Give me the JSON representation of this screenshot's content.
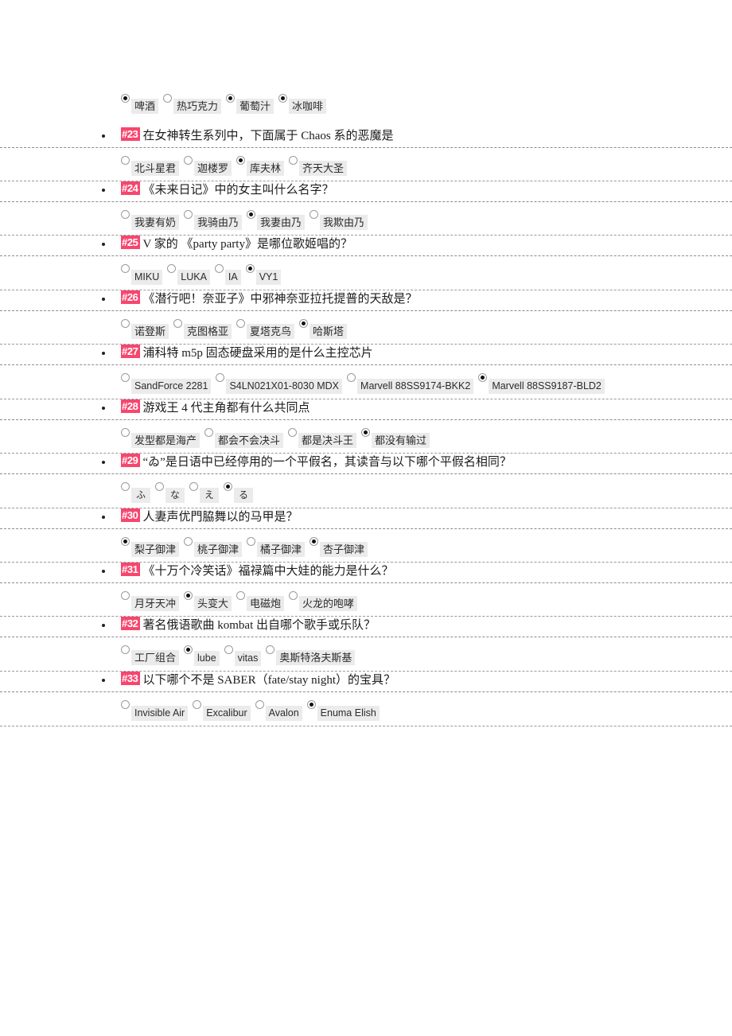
{
  "document": {
    "type": "quiz-answer-sheet",
    "badge_color": "#f7466e",
    "option_bg": "#ebebeb"
  },
  "partial_question": {
    "options": [
      {
        "label": "啤酒",
        "selected": true
      },
      {
        "label": "热巧克力",
        "selected": false
      },
      {
        "label": "葡萄汁",
        "selected": true
      },
      {
        "label": "冰咖啡",
        "selected": true
      }
    ]
  },
  "questions": [
    {
      "number": "#23",
      "text": "在女神转生系列中，下面属于 Chaos 系的恶魔是",
      "style": "cjk",
      "options": [
        {
          "label": "北斗星君",
          "selected": false
        },
        {
          "label": "迦楼罗",
          "selected": false
        },
        {
          "label": "库夫林",
          "selected": true
        },
        {
          "label": "齐天大圣",
          "selected": false
        }
      ]
    },
    {
      "number": "#24",
      "text": "《未来日记》中的女主叫什么名字？",
      "style": "cjk",
      "options": [
        {
          "label": "我妻有奶",
          "selected": false
        },
        {
          "label": "我骑由乃",
          "selected": false
        },
        {
          "label": "我妻由乃",
          "selected": true
        },
        {
          "label": "我欺由乃",
          "selected": false
        }
      ]
    },
    {
      "number": "#25",
      "text": "V 家的 《party party》是哪位歌姬唱的？",
      "style": "cjk",
      "options": [
        {
          "label": "MIKU",
          "selected": false,
          "latin": true
        },
        {
          "label": "LUKA",
          "selected": false,
          "latin": true
        },
        {
          "label": "IA",
          "selected": false,
          "latin": true
        },
        {
          "label": "VY1",
          "selected": true,
          "latin": true
        }
      ]
    },
    {
      "number": "#26",
      "text": "《潜行吧！奈亚子》中邪神奈亚拉托提普的天敌是？",
      "style": "cjk",
      "options": [
        {
          "label": "诺登斯",
          "selected": false
        },
        {
          "label": "克图格亚",
          "selected": false
        },
        {
          "label": "夏塔克鸟",
          "selected": false
        },
        {
          "label": "哈斯塔",
          "selected": true
        }
      ]
    },
    {
      "number": "#27",
      "text": "浦科特 m5p 固态硬盘采用的是什么主控芯片",
      "style": "cjk",
      "options": [
        {
          "label": "SandForce 2281",
          "selected": false,
          "latin": true
        },
        {
          "label": "S4LN021X01-8030 MDX",
          "selected": false,
          "latin": true
        },
        {
          "label": "Marvell 88SS9174-BKK2",
          "selected": false,
          "latin": true
        },
        {
          "label": "Marvell 88SS9187-BLD2",
          "selected": true,
          "latin": true
        }
      ]
    },
    {
      "number": "#28",
      "text": "游戏王 4 代主角都有什么共同点",
      "style": "cjk",
      "options": [
        {
          "label": "发型都是海产",
          "selected": false
        },
        {
          "label": "都会不会决斗",
          "selected": false
        },
        {
          "label": "都是决斗王",
          "selected": false
        },
        {
          "label": "都没有输过",
          "selected": true
        }
      ]
    },
    {
      "number": "#29",
      "text": "“ゐ”是日语中已经停用的一个平假名，其读音与以下哪个平假名相同？",
      "style": "cjk",
      "options": [
        {
          "label": "ふ",
          "selected": false,
          "jp": true
        },
        {
          "label": "な",
          "selected": false,
          "jp": true
        },
        {
          "label": "え",
          "selected": false,
          "jp": true
        },
        {
          "label": "る",
          "selected": true,
          "jp": true
        }
      ]
    },
    {
      "number": "#30",
      "text": "人妻声优門脇舞以的马甲是？",
      "style": "cjk",
      "options": [
        {
          "label": "梨子御津",
          "selected": true
        },
        {
          "label": "桃子御津",
          "selected": false
        },
        {
          "label": "橘子御津",
          "selected": false
        },
        {
          "label": "杏子御津",
          "selected": true
        }
      ]
    },
    {
      "number": "#31",
      "text": "《十万个冷笑话》福禄篇中大娃的能力是什么？",
      "style": "cjk",
      "options": [
        {
          "label": "月牙天冲",
          "selected": false
        },
        {
          "label": "头变大",
          "selected": true
        },
        {
          "label": "电磁炮",
          "selected": false
        },
        {
          "label": "火龙的咆哮",
          "selected": false
        }
      ]
    },
    {
      "number": "#32",
      "text": "著名俄语歌曲 kombat 出自哪个歌手或乐队？",
      "style": "cjk",
      "options": [
        {
          "label": "工厂组合",
          "selected": false
        },
        {
          "label": "lube",
          "selected": true,
          "latin": true
        },
        {
          "label": "vitas",
          "selected": false,
          "latin": true
        },
        {
          "label": "奥斯特洛夫斯基",
          "selected": false
        }
      ]
    },
    {
      "number": "#33",
      "text": "以下哪个不是 SABER（fate/stay night）的宝具？",
      "style": "cjk",
      "options": [
        {
          "label": "Invisible Air",
          "selected": false,
          "latin": true
        },
        {
          "label": "Excalibur",
          "selected": false,
          "latin": true
        },
        {
          "label": "Avalon",
          "selected": false,
          "latin": true
        },
        {
          "label": "Enuma Elish",
          "selected": true,
          "latin": true
        }
      ]
    }
  ]
}
